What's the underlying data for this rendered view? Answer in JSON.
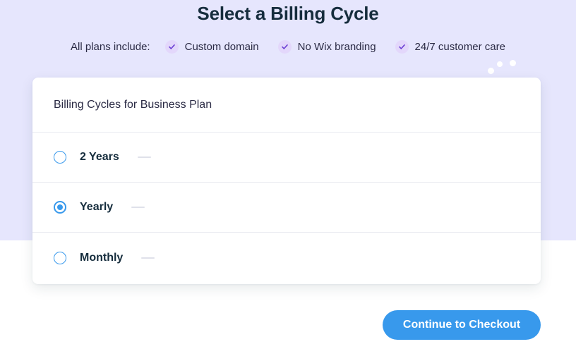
{
  "page": {
    "title": "Select a Billing Cycle",
    "background_color": "#e6e6fd",
    "accent_color": "#3899ec",
    "check_color": "#6b3fd4"
  },
  "includes": {
    "label": "All plans include:",
    "items": [
      {
        "icon": "check-icon",
        "text": "Custom domain"
      },
      {
        "icon": "check-icon",
        "text": "No Wix branding"
      },
      {
        "icon": "check-icon",
        "text": "24/7 customer care"
      }
    ]
  },
  "card": {
    "header_title": "Billing Cycles for Business Plan",
    "cycles": [
      {
        "label": "2 Years",
        "selected": false,
        "price": ""
      },
      {
        "label": "Yearly",
        "selected": true,
        "price": ""
      },
      {
        "label": "Monthly",
        "selected": false,
        "price": ""
      }
    ]
  },
  "footer": {
    "checkout_label": "Continue to Checkout"
  },
  "ghost_text": {
    "monthly": "",
    "yearly_a": "",
    "yearly_b": ""
  }
}
